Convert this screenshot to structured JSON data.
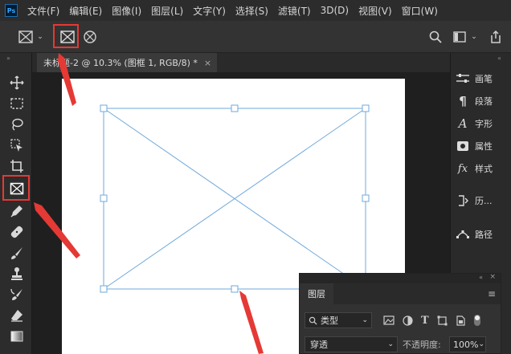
{
  "app": {
    "logo": "Ps"
  },
  "menu": [
    "文件(F)",
    "编辑(E)",
    "图像(I)",
    "图层(L)",
    "文字(Y)",
    "选择(S)",
    "滤镜(T)",
    "3D(D)",
    "视图(V)",
    "窗口(W)"
  ],
  "document": {
    "tab_title": "未标题-2 @ 10.3% (图框 1, RGB/8) *",
    "close_glyph": "×"
  },
  "panels": [
    "画笔",
    "段落",
    "字形",
    "属性",
    "样式",
    "历...",
    "路径"
  ],
  "layers_panel": {
    "tab": "图层",
    "filter_label": "类型",
    "blend_mode": "穿透",
    "opacity_label": "不透明度:",
    "opacity_value": "100%"
  },
  "colors": {
    "highlight_red": "#e53935",
    "frame_blue": "#6fa8dc"
  }
}
